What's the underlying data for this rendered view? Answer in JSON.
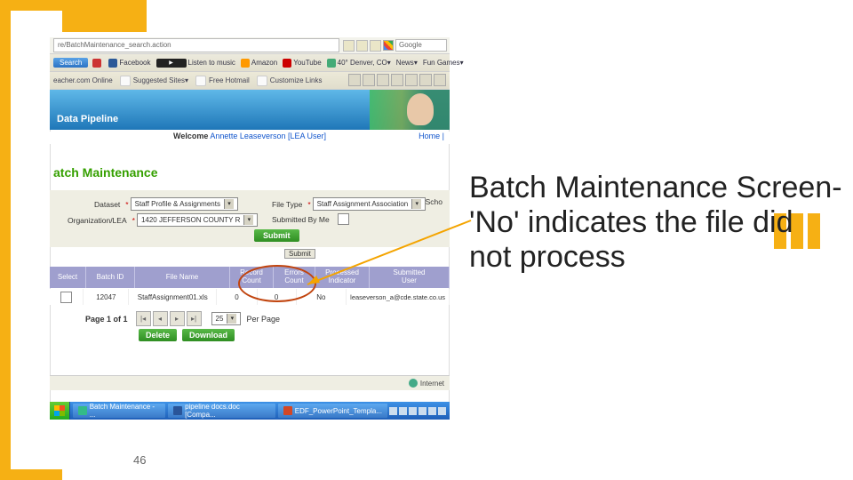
{
  "slide": {
    "number": "46"
  },
  "caption": "Batch Maintenance Screen-\n'No' indicates the  file did not process",
  "browser": {
    "url": "re/BatchMaintenance_search.action",
    "search_engine": "Google",
    "quickbar": {
      "search_btn": "Search",
      "items": [
        "Facebook",
        "Listen to music",
        "Amazon",
        "YouTube",
        "40° Denver, CO",
        "News",
        "Fun Games"
      ]
    },
    "sugbar": {
      "site": "eacher.com Online",
      "suggested": "Suggested Sites",
      "free": "Free Hotmail",
      "customize": "Customize Links"
    }
  },
  "app": {
    "banner_title": "Data Pipeline",
    "welcome_label": "Welcome",
    "welcome_user": "Annette Leaseverson [LEA User]",
    "home": "Home  |",
    "page_title": "atch Maintenance",
    "form": {
      "dataset_lbl": "Dataset",
      "dataset_val": "Staff Profile & Assignments",
      "filetype_lbl": "File Type",
      "filetype_val": "Staff Assignment Association",
      "school_lbl": "Scho",
      "org_lbl": "Organization/LEA",
      "org_val": "1420 JEFFERSON COUNTY R",
      "subby_lbl": "Submitted By Me",
      "submit": "Submit",
      "subsearch": "Submit"
    },
    "table": {
      "headers": {
        "select": "Select",
        "batch": "Batch ID",
        "file": "File Name",
        "record": "Record\nCount",
        "errors": "Errors\nCount",
        "proc": "Processed\nIndicator",
        "user": "Submitted\nUser"
      },
      "row": {
        "batch": "12047",
        "file": "StaffAssignment01.xls",
        "record": "0",
        "errors": "0",
        "proc": "No",
        "user": "leaseverson_a@cde.state.co.us"
      }
    },
    "pager": {
      "text": "Page 1 of 1",
      "first": "|◂",
      "prev": "◂",
      "next": "▸",
      "last": "▸|",
      "pp_val": "25",
      "pp_lbl": "Per Page"
    },
    "actions": {
      "delete": "Delete",
      "download": "Download"
    },
    "status": "Internet"
  },
  "taskbar": {
    "app": "Batch Maintenance - ...",
    "win1": "pipeline docs.doc [Compa...",
    "win2": "EDF_PowerPoint_Templa..."
  }
}
